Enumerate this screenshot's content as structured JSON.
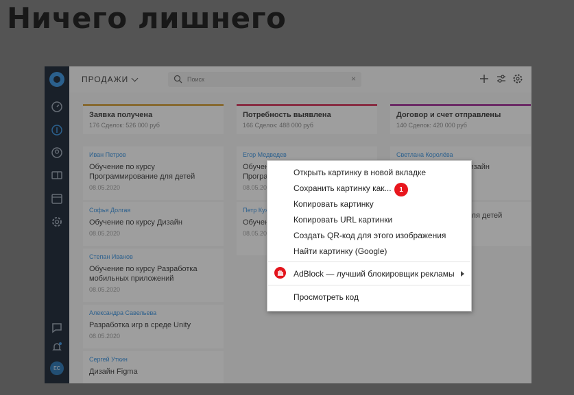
{
  "page": {
    "title": "Ничего лишнего"
  },
  "topbar": {
    "section": "ПРОДАЖИ",
    "search_placeholder": "Поиск"
  },
  "sidebar": {
    "avatar_initials": "ЕС"
  },
  "columns": [
    {
      "name": "Заявка получена",
      "summary": "176 Сделок: 526 000 руб",
      "accent": "#d5a13a",
      "cards": [
        {
          "person": "Иван Петров",
          "title": "Обучение по курсу Программирование для детей",
          "date": "08.05.2020"
        },
        {
          "person": "Софья Долгая",
          "title": "Обучение по курсу Дизайн",
          "date": "08.05.2020"
        },
        {
          "person": "Степан Иванов",
          "title": "Обучение по курсу Разработка мобильных приложений",
          "date": "08.05.2020"
        },
        {
          "person": "Александра Савельева",
          "title": "Разработка игр в среде Unity",
          "date": "08.05.2020"
        },
        {
          "person": "Сергей Уткин",
          "title": "Дизайн Figma",
          "date": ""
        }
      ]
    },
    {
      "name": "Потребность выявлена",
      "summary": "166 Сделок: 488 000 руб",
      "accent": "#d8325a",
      "cards": [
        {
          "person": "Егор Медведев",
          "title": "Обучение по курсу Программирование",
          "date": "08.05.2020"
        },
        {
          "person": "Петр Кузнецов",
          "title": "Обучение по курсу мобильные",
          "date": "08.05.2020"
        }
      ]
    },
    {
      "name": "Договор и счет отправлены",
      "summary": "140 Сделок: 420 000 руб",
      "accent": "#a22c9a",
      "cards": [
        {
          "person": "Светлана Королёва",
          "title": "Обучение по курсу Дизайн",
          "date": "08.05.2020"
        },
        {
          "person": "",
          "title": "Программирование для детей",
          "date": ""
        }
      ]
    }
  ],
  "context_menu": {
    "items": [
      "Открыть картинку в новой вкладке",
      "Сохранить картинку как...",
      "Копировать картинку",
      "Копировать URL картинки",
      "Создать QR-код для этого изображения",
      "Найти картинку (Google)"
    ],
    "badge": "1",
    "adblock": "AdBlock — лучший блокировщик рекламы",
    "inspect": "Просмотреть код"
  }
}
